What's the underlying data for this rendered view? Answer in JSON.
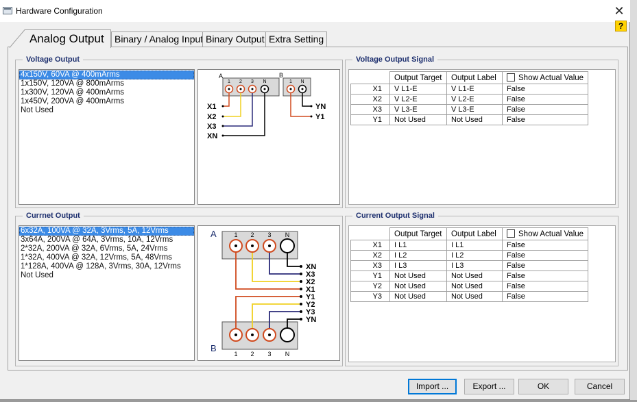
{
  "window": {
    "title": "Hardware Configuration",
    "help_label": "?"
  },
  "tabs": [
    {
      "label": "Analog Output"
    },
    {
      "label": "Binary / Analog Input"
    },
    {
      "label": "Binary Output"
    },
    {
      "label": "Extra Setting"
    }
  ],
  "voltage_output": {
    "title": "Voltage Output",
    "items": [
      "4x150V, 60VA @ 400mArms",
      "1x150V, 120VA @ 800mArms",
      "1x300V, 120VA @ 400mArms",
      "1x450V, 200VA @ 400mArms",
      "Not Used"
    ],
    "selected_index": 0,
    "diagram": {
      "group_a": "A",
      "group_b": "B",
      "a_terminals": [
        "1",
        "2",
        "3",
        "N"
      ],
      "b_terminals": [
        "1",
        "N"
      ],
      "left_labels": [
        "X1",
        "X2",
        "X3",
        "XN"
      ],
      "right_labels": [
        "YN",
        "Y1"
      ]
    }
  },
  "voltage_signal": {
    "title": "Voltage Output Signal",
    "headers": [
      "Output Target",
      "Output Label",
      "Show Actual Value"
    ],
    "rows": [
      {
        "name": "X1",
        "target": "V L1-E",
        "label": "V L1-E",
        "actual": "False"
      },
      {
        "name": "X2",
        "target": "V L2-E",
        "label": "V L2-E",
        "actual": "False"
      },
      {
        "name": "X3",
        "target": "V L3-E",
        "label": "V L3-E",
        "actual": "False"
      },
      {
        "name": "Y1",
        "target": "Not Used",
        "label": "Not Used",
        "actual": "False"
      }
    ]
  },
  "current_output": {
    "title": "Currnet Output",
    "items": [
      "6x32A, 100VA @ 32A, 3Vrms, 5A, 12Vrms",
      "3x64A, 200VA @ 64A, 3Vrms, 10A, 12Vrms",
      "2*32A, 200VA @ 32A, 6Vrms, 5A, 24Vrms",
      "1*32A, 400VA @ 32A, 12Vrms, 5A, 48Vrms",
      "1*128A, 400VA @ 128A, 3Vrms, 30A, 12Vrms",
      "Not Used"
    ],
    "selected_index": 0,
    "diagram": {
      "group_a": "A",
      "group_b": "B",
      "terminals": [
        "1",
        "2",
        "3",
        "N"
      ],
      "labels": [
        "XN",
        "X3",
        "X2",
        "X1",
        "Y1",
        "Y2",
        "Y3",
        "YN"
      ]
    }
  },
  "current_signal": {
    "title": "Current Output Signal",
    "headers": [
      "Output Target",
      "Output Label",
      "Show Actual Value"
    ],
    "rows": [
      {
        "name": "X1",
        "target": "I L1",
        "label": "I L1",
        "actual": "False"
      },
      {
        "name": "X2",
        "target": "I L2",
        "label": "I L2",
        "actual": "False"
      },
      {
        "name": "X3",
        "target": "I L3",
        "label": "I L3",
        "actual": "False"
      },
      {
        "name": "Y1",
        "target": "Not Used",
        "label": "Not Used",
        "actual": "False"
      },
      {
        "name": "Y2",
        "target": "Not Used",
        "label": "Not Used",
        "actual": "False"
      },
      {
        "name": "Y3",
        "target": "Not Used",
        "label": "Not Used",
        "actual": "False"
      }
    ]
  },
  "buttons": {
    "import": "Import ...",
    "export": "Export ...",
    "ok": "OK",
    "cancel": "Cancel"
  },
  "colors": {
    "wire_red": "#d04a1e",
    "wire_yellow": "#f0d020",
    "wire_blue": "#2a2a78",
    "wire_black": "#000000",
    "selection": "#3c8be6",
    "group_title": "#1d2f6e",
    "help_yellow": "#ffd200"
  }
}
